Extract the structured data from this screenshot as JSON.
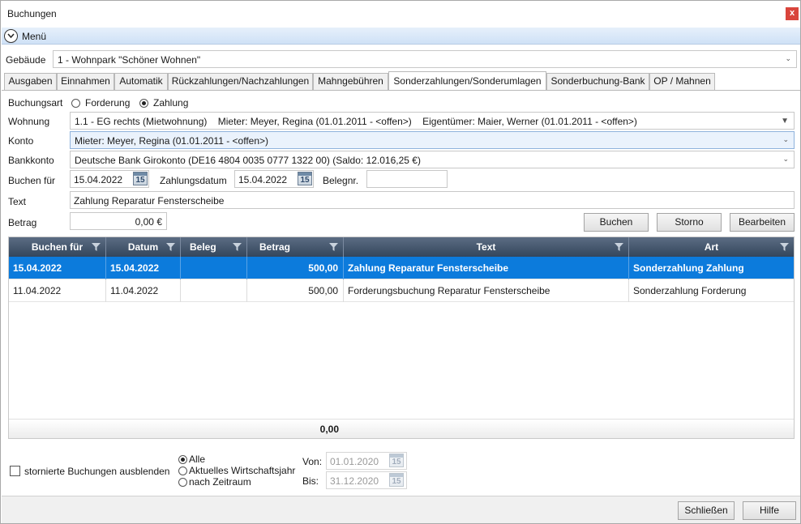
{
  "window": {
    "title": "Buchungen",
    "close_glyph": "x"
  },
  "menu": {
    "label": "Menü"
  },
  "gebaeude": {
    "label": "Gebäude",
    "value": "1 - Wohnpark \"Schöner Wohnen\""
  },
  "tabs": [
    "Ausgaben",
    "Einnahmen",
    "Automatik",
    "Rückzahlungen/Nachzahlungen",
    "Mahngebühren",
    "Sonderzahlungen/Sonderumlagen",
    "Sonderbuchung-Bank",
    "OP / Mahnen"
  ],
  "active_tab": "Sonderzahlungen/Sonderumlagen",
  "form": {
    "buchungsart_label": "Buchungsart",
    "buchungsart_options": [
      "Forderung",
      "Zahlung"
    ],
    "buchungsart_selected": "Zahlung",
    "wohnung_label": "Wohnung",
    "wohnung_value": "1.1 - EG rechts (Mietwohnung)    Mieter: Meyer, Regina (01.01.2011 - <offen>)    Eigentümer: Maier, Werner (01.01.2011 - <offen>)",
    "konto_label": "Konto",
    "konto_value": "Mieter: Meyer, Regina (01.01.2011 - <offen>)",
    "bankkonto_label": "Bankkonto",
    "bankkonto_value": "Deutsche Bank Girokonto (DE16 4804 0035 0777 1322 00) (Saldo: 12.016,25 €)",
    "buchen_fuer_label": "Buchen für",
    "buchen_fuer_value": "15.04.2022",
    "zahlungsdatum_label": "Zahlungsdatum",
    "zahlungsdatum_value": "15.04.2022",
    "belegnr_label": "Belegnr.",
    "belegnr_value": "",
    "text_label": "Text",
    "text_value": "Zahlung Reparatur Fensterscheibe",
    "betrag_label": "Betrag",
    "betrag_value": "0,00 €",
    "cal_day": "15"
  },
  "buttons": {
    "buchen": "Buchen",
    "storno": "Storno",
    "bearbeiten": "Bearbeiten",
    "schliessen": "Schließen",
    "hilfe": "Hilfe"
  },
  "grid": {
    "columns": [
      "Buchen für",
      "Datum",
      "Beleg",
      "Betrag",
      "Text",
      "Art"
    ],
    "rows": [
      {
        "buchen_fuer": "15.04.2022",
        "datum": "15.04.2022",
        "beleg": "",
        "betrag": "500,00",
        "text": "Zahlung Reparatur Fensterscheibe",
        "art": "Sonderzahlung Zahlung"
      },
      {
        "buchen_fuer": "11.04.2022",
        "datum": "11.04.2022",
        "beleg": "",
        "betrag": "500,00",
        "text": "Forderungsbuchung Reparatur Fensterscheibe",
        "art": "Sonderzahlung Forderung"
      }
    ],
    "total": "0,00"
  },
  "filter": {
    "stornierte_label": "stornierte Buchungen ausblenden",
    "zeitraum_options": [
      "Alle",
      "Aktuelles Wirtschaftsjahr",
      "nach Zeitraum"
    ],
    "zeitraum_selected": "Alle",
    "von_label": "Von:",
    "von_value": "01.01.2020",
    "bis_label": "Bis:",
    "bis_value": "31.12.2020"
  },
  "colors": {
    "accent": "#0c7bdc",
    "header_bg": "#3f5168",
    "close": "#d9453c"
  }
}
